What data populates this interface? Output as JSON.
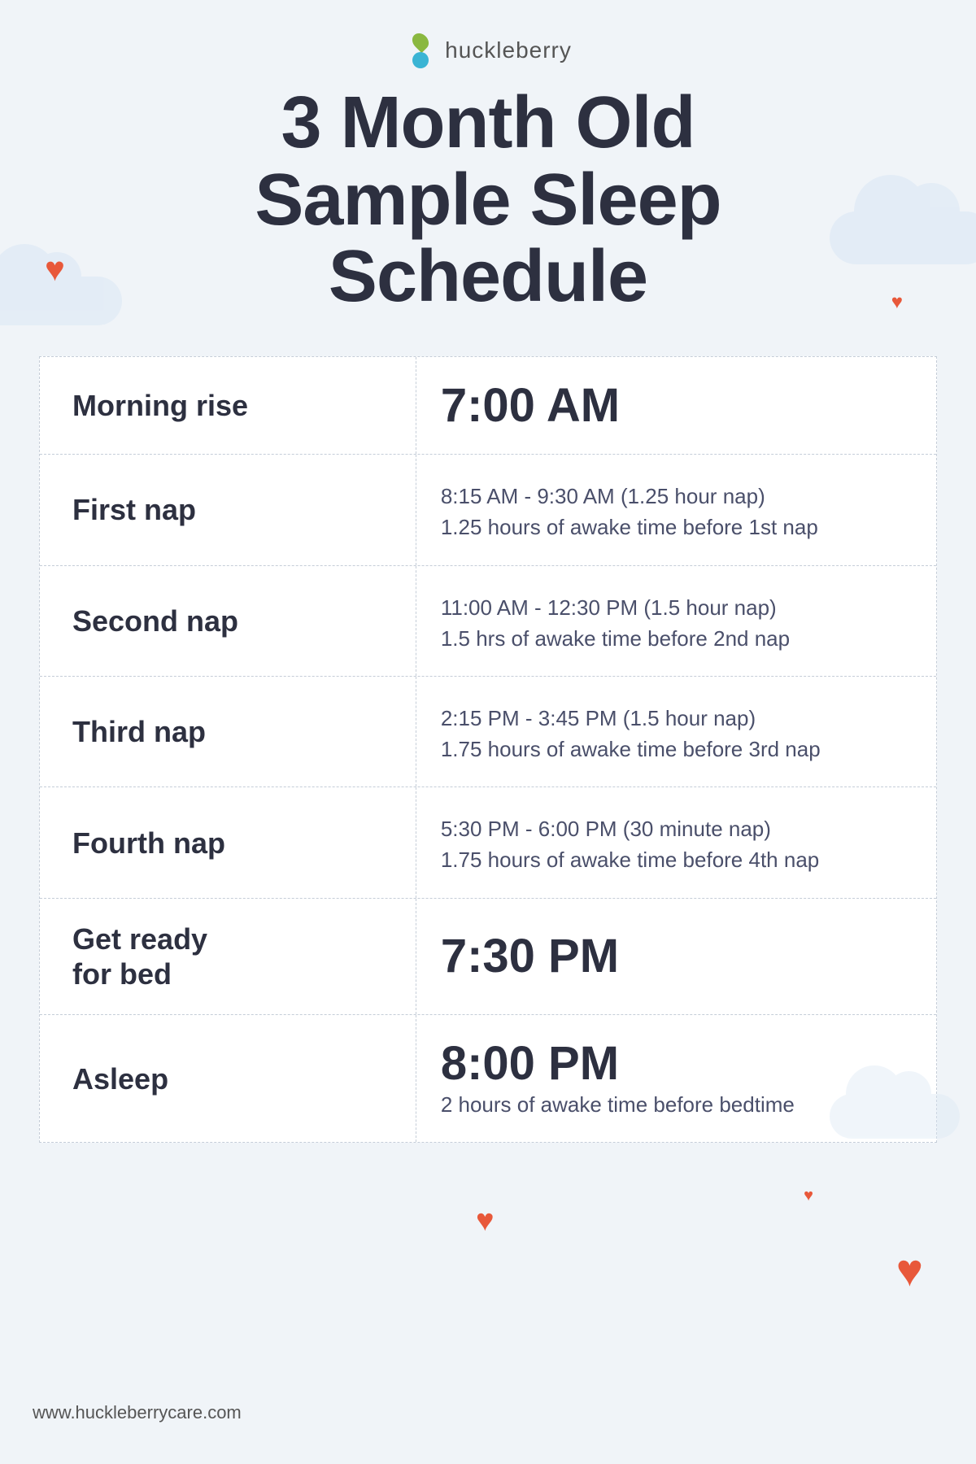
{
  "brand": {
    "name": "huckleberry",
    "url": "www.huckleberrycare.com"
  },
  "title": {
    "line1": "3 Month Old",
    "line2": "Sample Sleep",
    "line3": "Schedule"
  },
  "schedule": [
    {
      "id": "morning-rise",
      "label": "Morning rise",
      "time_large": "7:00 AM",
      "detail1": "",
      "detail2": ""
    },
    {
      "id": "first-nap",
      "label": "First nap",
      "time_large": "",
      "detail1": "8:15 AM - 9:30 AM (1.25 hour nap)",
      "detail2": "1.25 hours of awake time before 1st nap"
    },
    {
      "id": "second-nap",
      "label": "Second nap",
      "time_large": "",
      "detail1": "11:00 AM - 12:30 PM (1.5 hour nap)",
      "detail2": "1.5 hrs of awake time before 2nd nap"
    },
    {
      "id": "third-nap",
      "label": "Third nap",
      "time_large": "",
      "detail1": "2:15 PM - 3:45 PM (1.5 hour nap)",
      "detail2": "1.75 hours of awake time before 3rd nap"
    },
    {
      "id": "fourth-nap",
      "label": "Fourth nap",
      "time_large": "",
      "detail1": "5:30 PM - 6:00 PM (30 minute nap)",
      "detail2": "1.75 hours of awake time before 4th nap"
    },
    {
      "id": "get-ready",
      "label": "Get ready\nfor bed",
      "time_large": "7:30 PM",
      "detail1": "",
      "detail2": ""
    },
    {
      "id": "asleep",
      "label": "Asleep",
      "time_large": "8:00 PM",
      "detail1": "",
      "detail2": "2 hours of awake time before bedtime"
    }
  ],
  "hearts": {
    "color": "#e8583a"
  },
  "clouds": {
    "color": "#dce8f5"
  }
}
